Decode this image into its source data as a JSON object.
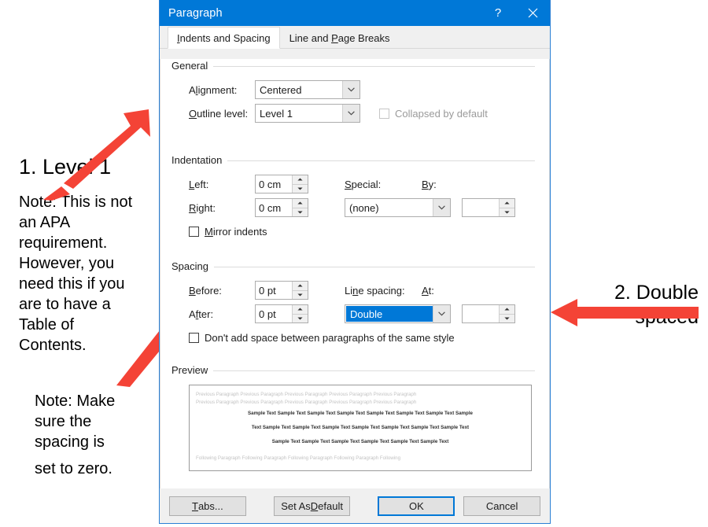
{
  "dialog": {
    "title": "Paragraph",
    "help_icon": "?",
    "close_icon": "close-icon",
    "tabs": [
      {
        "label": "Indents and Spacing",
        "underline_char": "I",
        "active": true
      },
      {
        "label": "Line and Page Breaks",
        "underline_char": "P",
        "active": false
      }
    ],
    "general": {
      "group_label": "General",
      "alignment_label": "Alignment:",
      "alignment_value": "Centered",
      "outline_label": "Outline level:",
      "outline_value": "Level 1",
      "collapsed_label": "Collapsed by default",
      "collapsed_checked": false,
      "collapsed_disabled": true
    },
    "indentation": {
      "group_label": "Indentation",
      "left_label": "Left:",
      "left_value": "0 cm",
      "right_label": "Right:",
      "right_value": "0 cm",
      "special_label": "Special:",
      "special_value": "(none)",
      "by_label": "By:",
      "by_value": "",
      "mirror_label": "Mirror indents",
      "mirror_checked": false
    },
    "spacing": {
      "group_label": "Spacing",
      "before_label": "Before:",
      "before_value": "0 pt",
      "after_label": "After:",
      "after_value": "0 pt",
      "line_spacing_label": "Line spacing:",
      "line_spacing_value": "Double",
      "at_label": "At:",
      "at_value": "",
      "dont_add_label": "Don't add space between paragraphs of the same style",
      "dont_add_checked": false
    },
    "preview": {
      "group_label": "Preview",
      "prev_line_1": "Previous Paragraph Previous Paragraph Previous Paragraph Previous Paragraph Previous Paragraph",
      "prev_line_2": "Previous Paragraph Previous Paragraph Previous Paragraph Previous Paragraph Previous Paragraph",
      "sample_line_1": "Sample Text Sample Text Sample Text Sample Text Sample Text Sample Text Sample Text Sample",
      "sample_line_2": "Text Sample Text Sample Text Sample Text Sample Text Sample Text Sample Text Sample Text",
      "sample_line_3": "Sample Text Sample Text Sample Text Sample Text Sample Text Sample Text",
      "following_line": "Following Paragraph Following Paragraph Following Paragraph Following Paragraph Following"
    },
    "footer": {
      "tabs_button": "Tabs...",
      "set_default_button": "Set As Default",
      "ok_button": "OK",
      "cancel_button": "Cancel"
    }
  },
  "annotations": {
    "arrow_color": "#f44336",
    "callout_1": {
      "title": "1. Level 1",
      "note": "Note: This is not an APA requirement. However, you need this if you are to have a Table of Contents."
    },
    "callout_2": {
      "title": "2. Double spaced"
    },
    "callout_3": {
      "note_main": "Note: Make sure the spacing is",
      "note_last": "set to zero."
    }
  }
}
